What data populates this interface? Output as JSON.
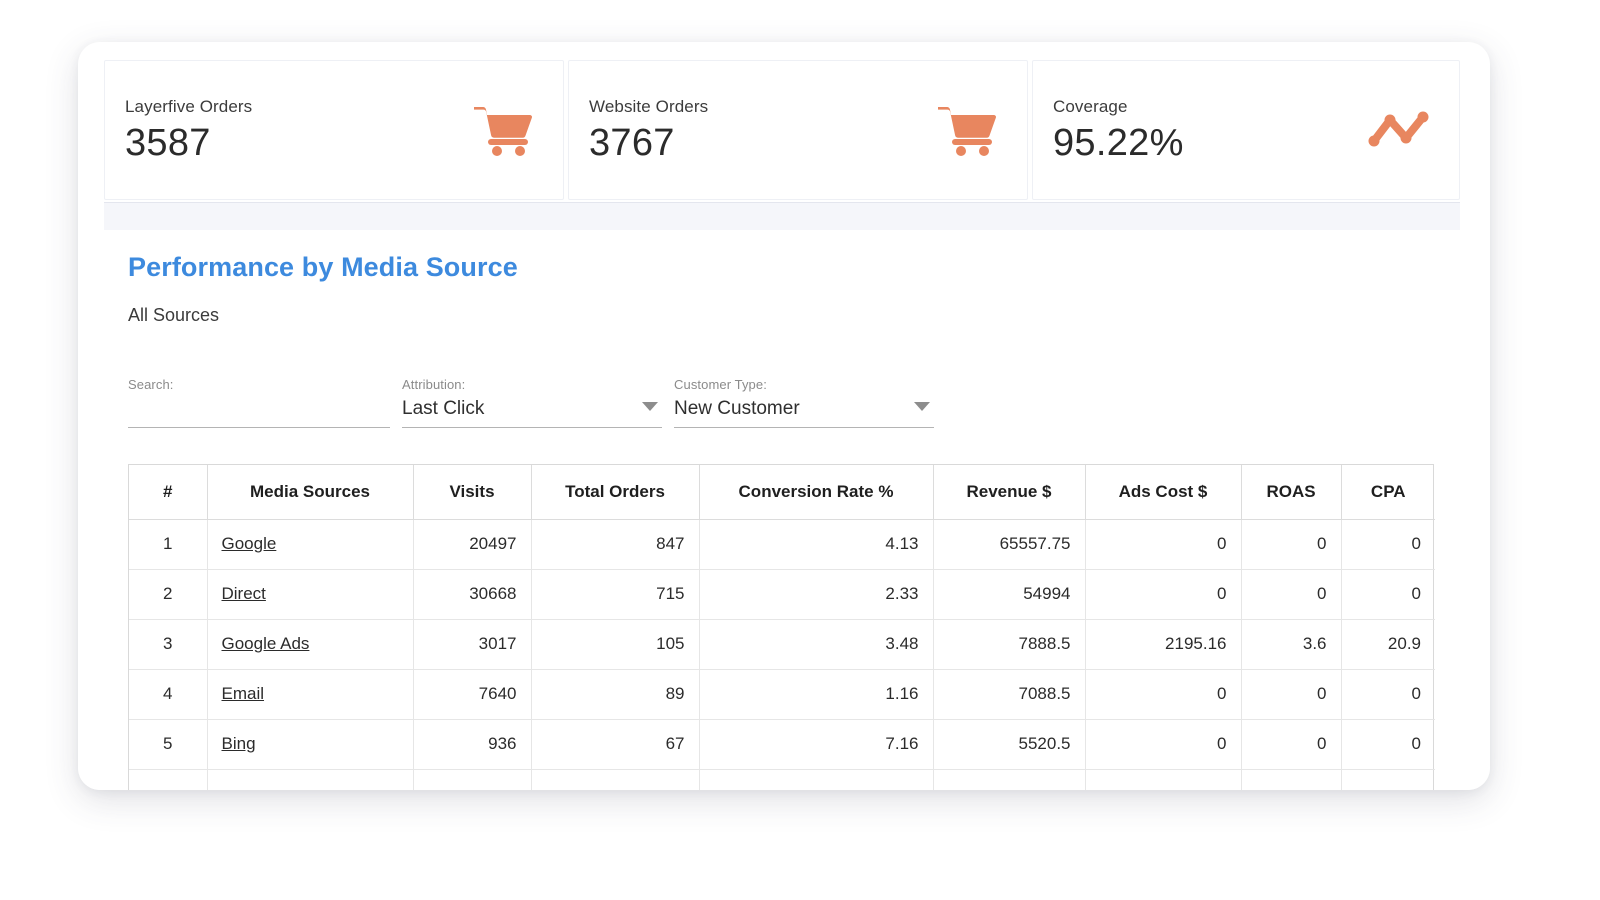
{
  "kpis": [
    {
      "label": "Layerfive Orders",
      "value": "3587",
      "icon": "shopping-cart-icon"
    },
    {
      "label": "Website Orders",
      "value": "3767",
      "icon": "shopping-cart-icon"
    },
    {
      "label": "Coverage",
      "value": "95.22%",
      "icon": "trend-line-icon"
    }
  ],
  "section": {
    "title": "Performance by Media Source",
    "subtitle": "All Sources"
  },
  "filters": {
    "search": {
      "label": "Search:",
      "value": "",
      "placeholder": ""
    },
    "attribution": {
      "label": "Attribution:",
      "value": "Last Click"
    },
    "customer_type": {
      "label": "Customer Type:",
      "value": "New Customer"
    }
  },
  "table": {
    "columns": [
      "#",
      "Media Sources",
      "Visits",
      "Total Orders",
      "Conversion Rate %",
      "Revenue $",
      "Ads Cost $",
      "ROAS",
      "CPA"
    ],
    "rows": [
      {
        "index": "1",
        "source": "Google",
        "visits": "20497",
        "total_orders": "847",
        "conversion_rate": "4.13",
        "revenue": "65557.75",
        "ads_cost": "0",
        "roas": "0",
        "cpa": "0"
      },
      {
        "index": "2",
        "source": "Direct",
        "visits": "30668",
        "total_orders": "715",
        "conversion_rate": "2.33",
        "revenue": "54994",
        "ads_cost": "0",
        "roas": "0",
        "cpa": "0"
      },
      {
        "index": "3",
        "source": "Google Ads",
        "visits": "3017",
        "total_orders": "105",
        "conversion_rate": "3.48",
        "revenue": "7888.5",
        "ads_cost": "2195.16",
        "roas": "3.6",
        "cpa": "20.9"
      },
      {
        "index": "4",
        "source": "Email",
        "visits": "7640",
        "total_orders": "89",
        "conversion_rate": "1.16",
        "revenue": "7088.5",
        "ads_cost": "0",
        "roas": "0",
        "cpa": "0"
      },
      {
        "index": "5",
        "source": "Bing",
        "visits": "936",
        "total_orders": "67",
        "conversion_rate": "7.16",
        "revenue": "5520.5",
        "ads_cost": "0",
        "roas": "0",
        "cpa": "0"
      }
    ]
  },
  "colors": {
    "accent_orange": "#e8865f",
    "title_blue": "#3d8ade",
    "band_grey": "#f5f6fa"
  }
}
